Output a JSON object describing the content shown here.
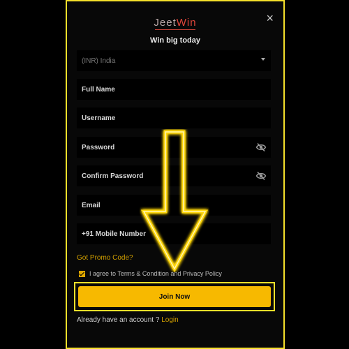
{
  "header": {
    "logo_text_a": "Jeet",
    "logo_text_b": "Win",
    "tagline": "Win big today",
    "close_icon": "×"
  },
  "form": {
    "country": "(INR) India",
    "full_name_placeholder": "Full Name",
    "username_placeholder": "Username",
    "password_placeholder": "Password",
    "confirm_password_placeholder": "Confirm Password",
    "email_placeholder": "Email",
    "mobile_placeholder": "+91 Mobile Number",
    "promo_link": "Got Promo Code?",
    "agree_text": "I agree to Terms & Condition and Privacy Policy",
    "agree_checked": true,
    "submit_label": "Join Now",
    "login_prompt": "Already have an account ?",
    "login_link": "Login"
  },
  "colors": {
    "accent": "#f7b900",
    "highlight": "#f5e02a",
    "background": "#080808"
  },
  "icons": {
    "close": "close-icon",
    "password_toggle": "eye-slash-icon",
    "annotation": "arrow-down-icon"
  }
}
